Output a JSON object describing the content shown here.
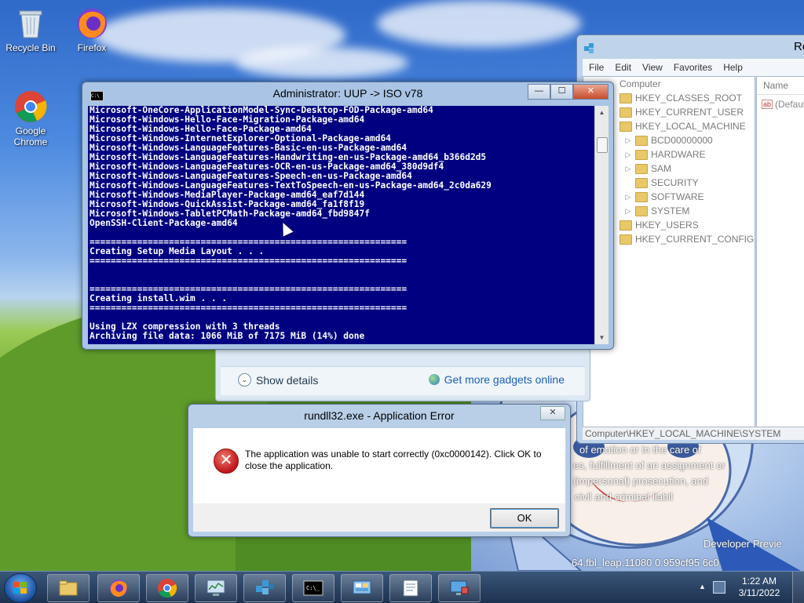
{
  "desktop": {
    "icons": [
      {
        "label": "Recycle Bin"
      },
      {
        "label": "Firefox"
      },
      {
        "label": "Google Chrome"
      }
    ]
  },
  "wallpaper_text": {
    "line1": "of emotion or in the care of",
    "line2": "es, fulfillment of an assignment or",
    "line3": "(impersonal) prosecution, and",
    "line4": "civil and criminal liabil",
    "dev_preview": "Developer Previe",
    "build": "64.fbl_leap.11080        0.959cf95        6c0"
  },
  "regedit": {
    "title": "Re",
    "menu": [
      "File",
      "Edit",
      "View",
      "Favorites",
      "Help"
    ],
    "tree_root": "Computer",
    "tree": [
      {
        "label": "HKEY_CLASSES_ROOT",
        "level": 1
      },
      {
        "label": "HKEY_CURRENT_USER",
        "level": 1
      },
      {
        "label": "HKEY_LOCAL_MACHINE",
        "level": 1
      },
      {
        "label": "BCD00000000",
        "level": 2
      },
      {
        "label": "HARDWARE",
        "level": 2
      },
      {
        "label": "SAM",
        "level": 2
      },
      {
        "label": "SECURITY",
        "level": 2
      },
      {
        "label": "SOFTWARE",
        "level": 2
      },
      {
        "label": "SYSTEM",
        "level": 2
      },
      {
        "label": "HKEY_USERS",
        "level": 1
      },
      {
        "label": "HKEY_CURRENT_CONFIG",
        "level": 1
      }
    ],
    "list_header": "Name",
    "list_value": "(Defaul",
    "status": "Computer\\HKEY_LOCAL_MACHINE\\SYSTEM"
  },
  "gadgets": {
    "show_details": "Show details",
    "get_more": "Get more gadgets online"
  },
  "console": {
    "title": "Administrator:  UUP -> ISO v78",
    "lines": [
      "Microsoft-OneCore-ApplicationModel-Sync-Desktop-FOD-Package-amd64",
      "Microsoft-Windows-Hello-Face-Migration-Package-amd64",
      "Microsoft-Windows-Hello-Face-Package-amd64",
      "Microsoft-Windows-InternetExplorer-Optional-Package-amd64",
      "Microsoft-Windows-LanguageFeatures-Basic-en-us-Package-amd64",
      "Microsoft-Windows-LanguageFeatures-Handwriting-en-us-Package-amd64_b366d2d5",
      "Microsoft-Windows-LanguageFeatures-OCR-en-us-Package-amd64_380d9df4",
      "Microsoft-Windows-LanguageFeatures-Speech-en-us-Package-amd64",
      "Microsoft-Windows-LanguageFeatures-TextToSpeech-en-us-Package-amd64_2c0da629",
      "Microsoft-Windows-MediaPlayer-Package-amd64_eaf7d144",
      "Microsoft-Windows-QuickAssist-Package-amd64_fa1f8f19",
      "Microsoft-Windows-TabletPCMath-Package-amd64_fbd9847f",
      "OpenSSH-Client-Package-amd64",
      "",
      "============================================================",
      "Creating Setup Media Layout . . .",
      "============================================================",
      "",
      "",
      "============================================================",
      "Creating install.wim . . .",
      "============================================================",
      "",
      "Using LZX compression with 3 threads",
      "Archiving file data: 1066 MiB of 7175 MiB (14%) done"
    ]
  },
  "dialog": {
    "title": "rundll32.exe - Application Error",
    "message": "The application was unable to start correctly (0xc0000142). Click OK to close the application.",
    "ok": "OK"
  },
  "taskbar": {
    "buttons": [
      "explorer",
      "firefox",
      "chrome",
      "performance-monitor",
      "regedit",
      "command-prompt",
      "control-panel",
      "notepad",
      "remote-desktop"
    ],
    "time": "1:22 AM",
    "date": "3/11/2022"
  },
  "colors": {
    "console_bg": "#000080",
    "console_fg": "#ffffff",
    "error_red": "#c0151a",
    "link_blue": "#1a5fb4"
  }
}
